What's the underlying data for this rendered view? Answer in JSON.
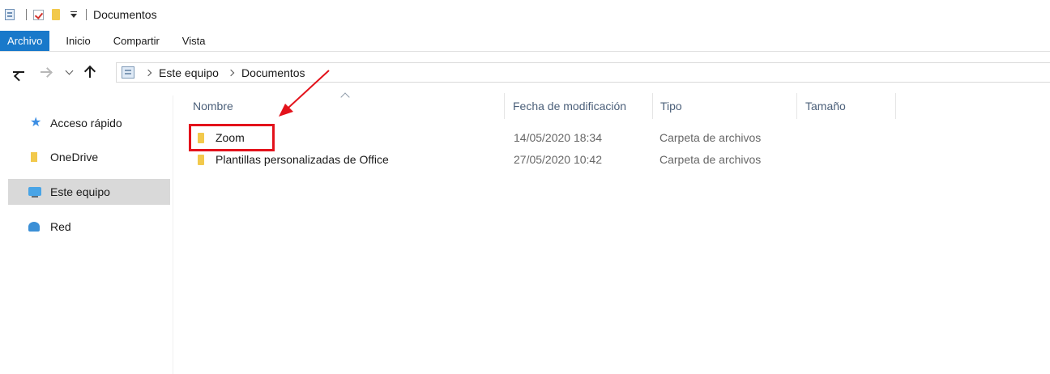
{
  "window": {
    "title": "Documentos"
  },
  "ribbon": {
    "tabs": [
      "Archivo",
      "Inicio",
      "Compartir",
      "Vista"
    ]
  },
  "address": {
    "crumbs": [
      "Este equipo",
      "Documentos"
    ]
  },
  "sidebar": {
    "items": [
      {
        "label": "Acceso rápido",
        "icon": "star-icon"
      },
      {
        "label": "OneDrive",
        "icon": "folder-icon"
      },
      {
        "label": "Este equipo",
        "icon": "computer-icon"
      },
      {
        "label": "Red",
        "icon": "network-icon"
      }
    ],
    "selected": "Este equipo"
  },
  "columns": {
    "name": "Nombre",
    "date": "Fecha de modificación",
    "type": "Tipo",
    "size": "Tamaño"
  },
  "files": [
    {
      "name": "Zoom",
      "date": "14/05/2020 18:34",
      "type": "Carpeta de archivos",
      "size": ""
    },
    {
      "name": "Plantillas personalizadas de Office",
      "date": "27/05/2020 10:42",
      "type": "Carpeta de archivos",
      "size": ""
    }
  ],
  "colors": {
    "accent": "#1979ca",
    "annotation": "#e3121b",
    "folder": "#f2c94c"
  }
}
